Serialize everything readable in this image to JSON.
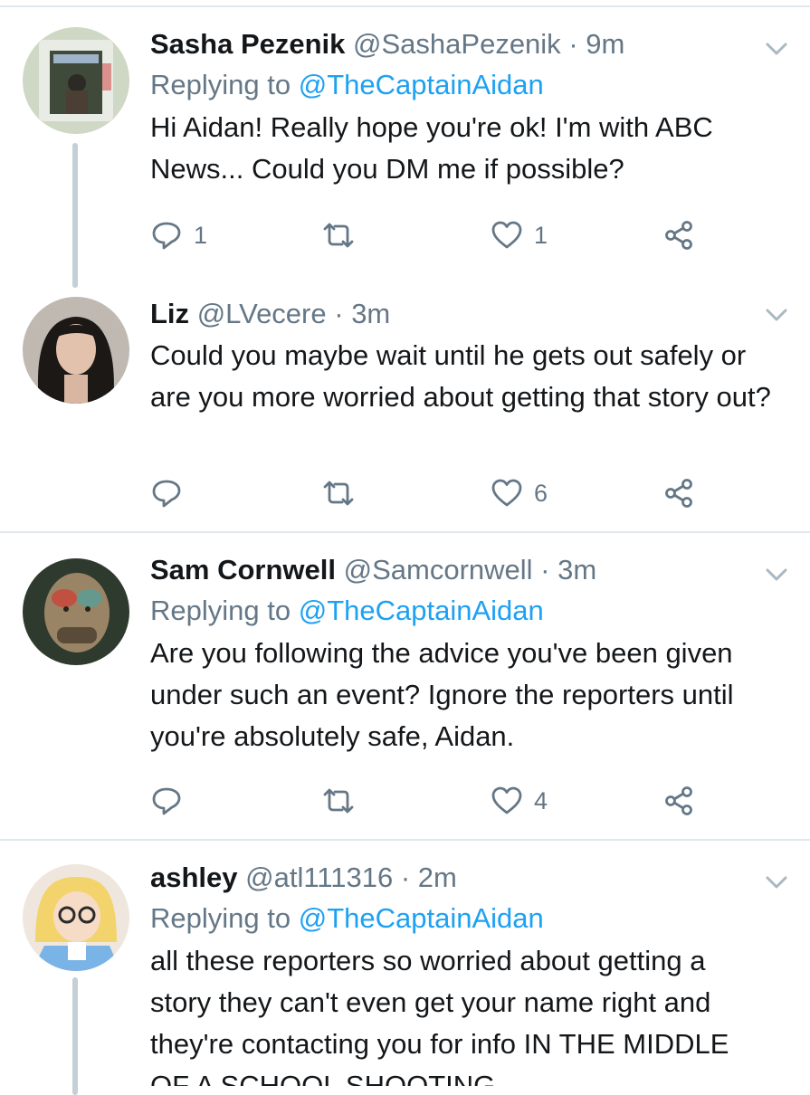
{
  "colors": {
    "accent": "#1da1f2",
    "muted": "#657786",
    "text": "#14171a",
    "divider": "#e1e8ed"
  },
  "tweets": [
    {
      "name": "Sasha Pezenik",
      "handle": "@SashaPezenik",
      "dot": "·",
      "time": "9m",
      "replying_prefix": "Replying to ",
      "replying_to": "@TheCaptainAidan",
      "text": "Hi Aidan! Really hope you're ok! I'm with ABC News... Could you DM me if possible?",
      "reply_count": "1",
      "retweet_count": "",
      "like_count": "1"
    },
    {
      "name": "Liz",
      "handle": "@LVecere",
      "dot": "·",
      "time": "3m",
      "text": "Could you maybe wait until he gets out safely or are you more worried about getting that story out?",
      "reply_count": "",
      "retweet_count": "",
      "like_count": "6"
    },
    {
      "name": "Sam Cornwell",
      "handle": "@Samcornwell",
      "dot": "·",
      "time": "3m",
      "replying_prefix": "Replying to ",
      "replying_to": "@TheCaptainAidan",
      "text": "Are you following the advice you've been given under such an event? Ignore the reporters until you're absolutely safe, Aidan.",
      "reply_count": "",
      "retweet_count": "",
      "like_count": "4"
    },
    {
      "name": "ashley",
      "handle": "@atl111316",
      "dot": "·",
      "time": "2m",
      "replying_prefix": "Replying to ",
      "replying_to": "@TheCaptainAidan",
      "text": "all these reporters so worried about getting a story they can't even get your name right and they're contacting you for info IN THE MIDDLE OF A SCHOOL SHOOTING"
    }
  ],
  "icons": {
    "reply": "reply-icon",
    "retweet": "retweet-icon",
    "like": "heart-icon",
    "share": "share-icon",
    "more": "chevron-down-icon"
  }
}
